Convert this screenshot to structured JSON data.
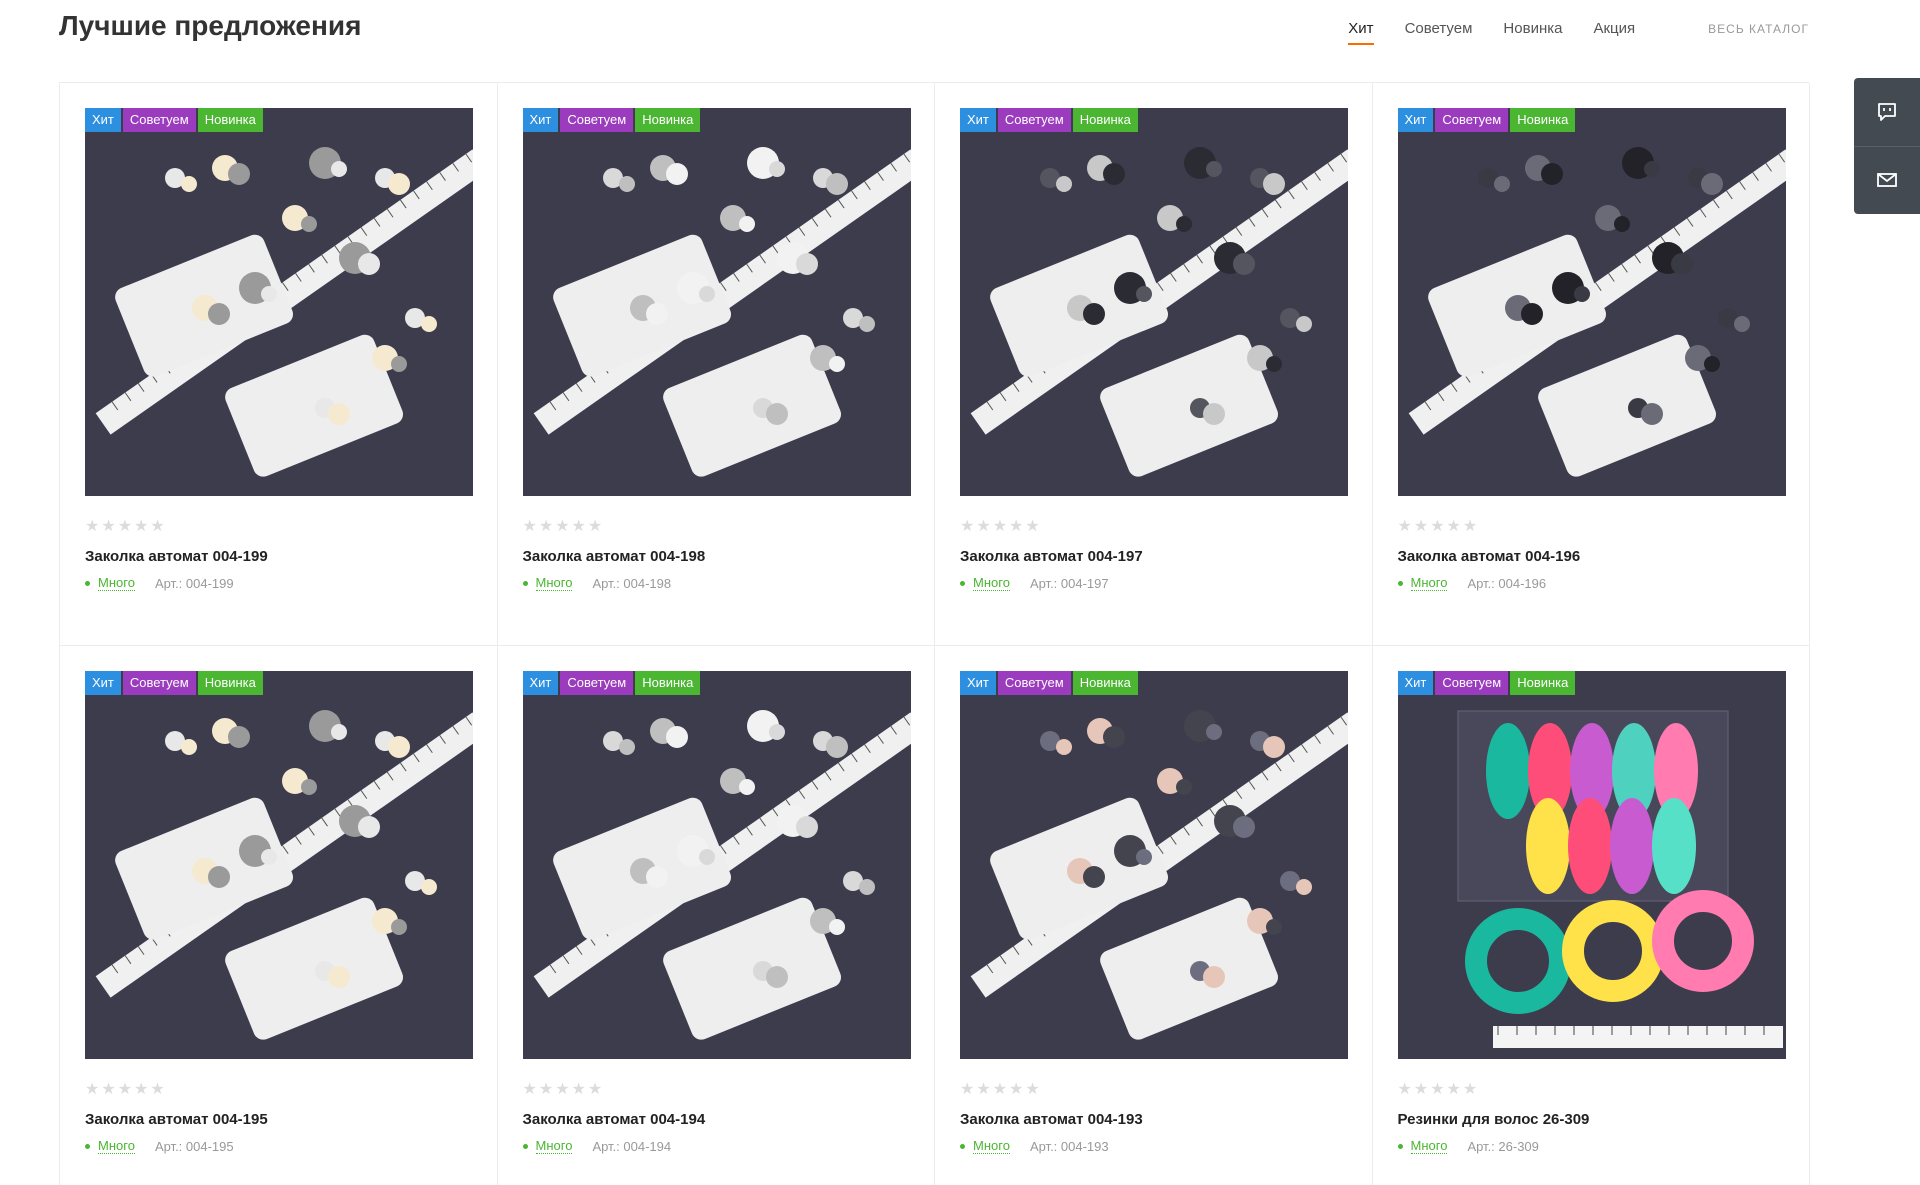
{
  "header": {
    "title": "Лучшие предложения",
    "tabs": [
      {
        "label": "Хит",
        "active": true
      },
      {
        "label": "Советуем",
        "active": false
      },
      {
        "label": "Новинка",
        "active": false
      },
      {
        "label": "Акция",
        "active": false
      }
    ],
    "catalog_link": "Весь каталог"
  },
  "stickers": {
    "hit": "Хит",
    "recommend": "Советуем",
    "new": "Новинка"
  },
  "products": [
    {
      "name": "Заколка автомат 004-199",
      "stock": "Много",
      "sku": "Арт.: 004-199",
      "rating": 0,
      "image": "hair-clip-flowers-icon"
    },
    {
      "name": "Заколка автомат 004-198",
      "stock": "Много",
      "sku": "Арт.: 004-198",
      "rating": 0,
      "image": "hair-clip-pearls-icon"
    },
    {
      "name": "Заколка автомат 004-197",
      "stock": "Много",
      "sku": "Арт.: 004-197",
      "rating": 0,
      "image": "hair-clip-bows-icon"
    },
    {
      "name": "Заколка автомат 004-196",
      "stock": "Много",
      "sku": "Арт.: 004-196",
      "rating": 0,
      "image": "hair-clip-bows-dark-icon"
    },
    {
      "name": "Заколка автомат 004-195",
      "stock": "Много",
      "sku": "Арт.: 004-195",
      "rating": 0,
      "image": "hair-clip-flowers-icon"
    },
    {
      "name": "Заколка автомат 004-194",
      "stock": "Много",
      "sku": "Арт.: 004-194",
      "rating": 0,
      "image": "hair-clip-pearls-icon"
    },
    {
      "name": "Заколка автомат 004-193",
      "stock": "Много",
      "sku": "Арт.: 004-193",
      "rating": 0,
      "image": "hair-clip-crystals-icon"
    },
    {
      "name": "Резинки для волос 26-309",
      "stock": "Много",
      "sku": "Арт.: 26-309",
      "rating": 0,
      "image": "hair-ties-icon"
    }
  ],
  "side_panel": {
    "items": [
      "chat-icon",
      "mail-icon"
    ]
  },
  "colors": {
    "hit": "#2d8fe0",
    "recommend": "#9b3bbd",
    "new": "#4ab631",
    "accent": "#ff6a00",
    "stock": "#4ab631",
    "photo_bg": "#3a3a4a"
  }
}
